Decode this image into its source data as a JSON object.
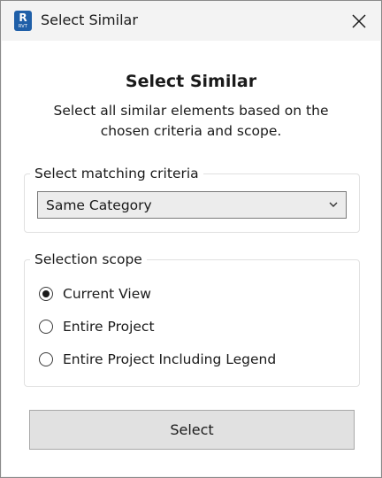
{
  "window": {
    "title": "Select Similar",
    "app_icon": {
      "letter": "R",
      "caption": "RVT",
      "color": "#1f5fa8"
    },
    "close_icon": "close-icon"
  },
  "main": {
    "heading": "Select Similar",
    "description": "Select all similar elements based on the chosen criteria and scope."
  },
  "criteria": {
    "legend": "Select matching criteria",
    "selected": "Same Category",
    "dropdown_icon": "chevron-down-icon"
  },
  "scope": {
    "legend": "Selection scope",
    "options": [
      {
        "label": "Current View",
        "checked": true
      },
      {
        "label": "Entire Project",
        "checked": false
      },
      {
        "label": "Entire Project Including Legend",
        "checked": false
      }
    ]
  },
  "actions": {
    "select_label": "Select"
  }
}
